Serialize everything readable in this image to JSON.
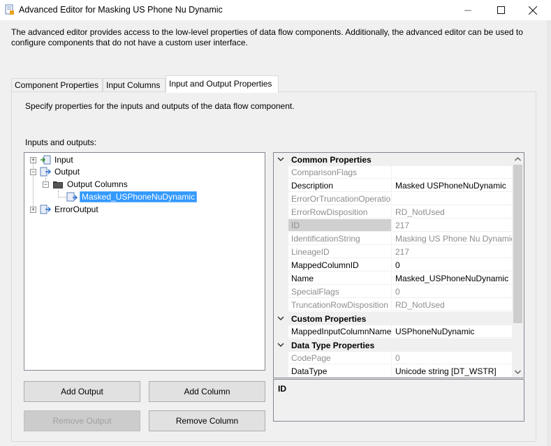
{
  "window": {
    "title": "Advanced Editor for Masking US Phone Nu Dynamic",
    "icons": [
      "app-icon",
      "minimize-icon",
      "maximize-icon",
      "close-icon"
    ]
  },
  "description": "The advanced editor provides access to the low-level properties of data flow components. Additionally, the advanced editor can be used to configure components that do not have a custom user interface.",
  "tabs": [
    {
      "label": "Component Properties"
    },
    {
      "label": "Input Columns"
    },
    {
      "label": "Input and Output Properties",
      "active": true
    }
  ],
  "panel": {
    "instructions": "Specify properties for the inputs and outputs of the data flow component.",
    "tree_label": "Inputs and outputs:",
    "tree": {
      "input": "Input",
      "output": "Output",
      "output_columns": "Output Columns",
      "masked_column": "Masked_USPhoneNuDynamic",
      "error_output": "ErrorOutput"
    },
    "buttons": {
      "add_output": "Add Output",
      "add_column": "Add Column",
      "remove_output": "Remove Output",
      "remove_column": "Remove Column"
    }
  },
  "properties": {
    "categories": {
      "common": "Common Properties",
      "custom": "Custom Properties",
      "data_type": "Data Type Properties"
    },
    "rows": [
      {
        "name": "ComparisonFlags",
        "value": "",
        "readonly": true
      },
      {
        "name": "Description",
        "value": "Masked USPhoneNuDynamic",
        "readonly": false
      },
      {
        "name": "ErrorOrTruncationOperation",
        "value": "",
        "readonly": true
      },
      {
        "name": "ErrorRowDisposition",
        "value": "RD_NotUsed",
        "readonly": true
      },
      {
        "name": "ID",
        "value": "217",
        "readonly": true,
        "selected": true
      },
      {
        "name": "IdentificationString",
        "value": "Masking US Phone Nu Dynamic",
        "readonly": true
      },
      {
        "name": "LineageID",
        "value": "217",
        "readonly": true
      },
      {
        "name": "MappedColumnID",
        "value": "0",
        "readonly": false
      },
      {
        "name": "Name",
        "value": "Masked_USPhoneNuDynamic",
        "readonly": false
      },
      {
        "name": "SpecialFlags",
        "value": "0",
        "readonly": true
      },
      {
        "name": "TruncationRowDisposition",
        "value": "RD_NotUsed",
        "readonly": true
      },
      {
        "name": "MappedInputColumnName",
        "value": "USPhoneNuDynamic",
        "readonly": false
      },
      {
        "name": "CodePage",
        "value": "0",
        "readonly": true
      },
      {
        "name": "DataType",
        "value": "Unicode string [DT_WSTR]",
        "readonly": false
      }
    ],
    "description_title": "ID"
  }
}
